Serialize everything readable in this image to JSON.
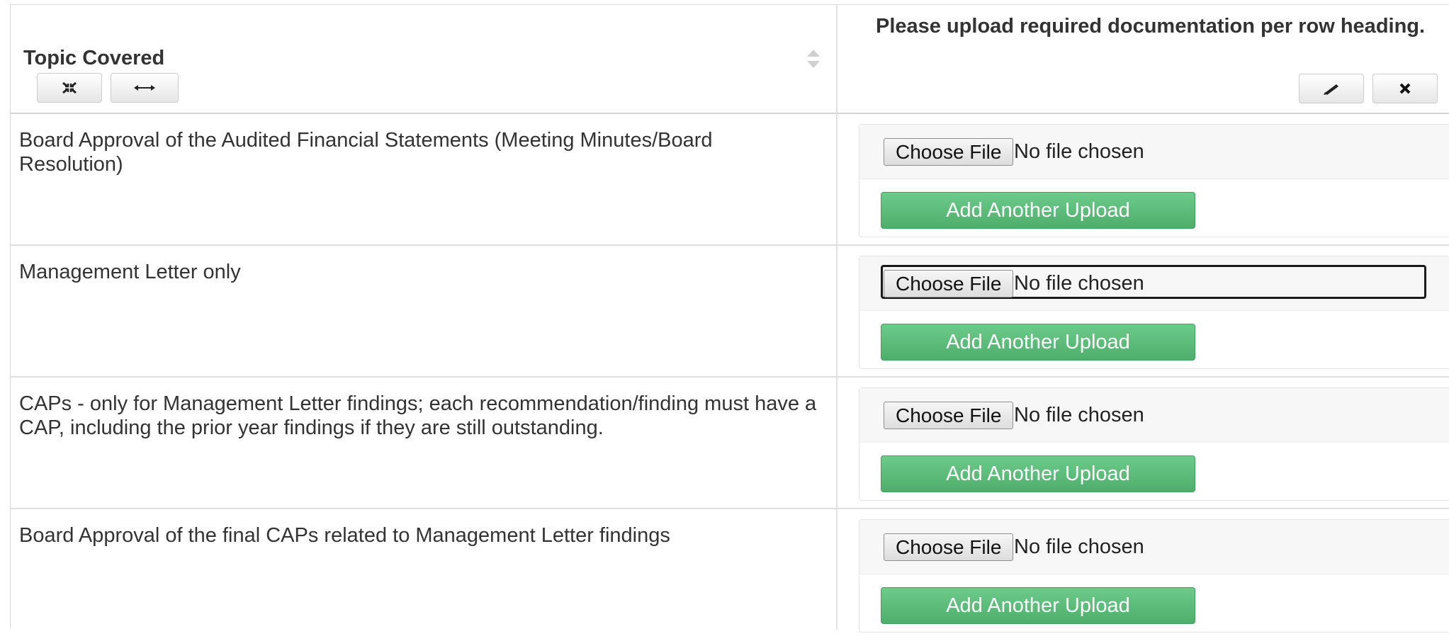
{
  "header": {
    "topic_label": "Topic Covered",
    "upload_label": "Please upload required documentation per row heading.",
    "icons": {
      "shrink": "compress-arrows-icon",
      "width": "horizontal-arrows-icon",
      "edit": "pencil-icon",
      "remove": "close-icon",
      "sort": "sort-icon"
    }
  },
  "file_input": {
    "button_label": "Choose File",
    "status": "No file chosen"
  },
  "add_upload_label": "Add Another Upload",
  "rows": [
    {
      "topic": "Board Approval of the Audited Financial Statements (Meeting Minutes/Board Resolution)"
    },
    {
      "topic": "Management Letter only"
    },
    {
      "topic": "CAPs - only for Management Letter findings; each recommendation/finding must have a CAP, including the prior year findings if they are still outstanding."
    },
    {
      "topic": "Board Approval of the final CAPs related to Management Letter findings"
    }
  ],
  "colors": {
    "add_button": "#5cb877",
    "border": "#d8d8d8",
    "text": "#333333"
  }
}
